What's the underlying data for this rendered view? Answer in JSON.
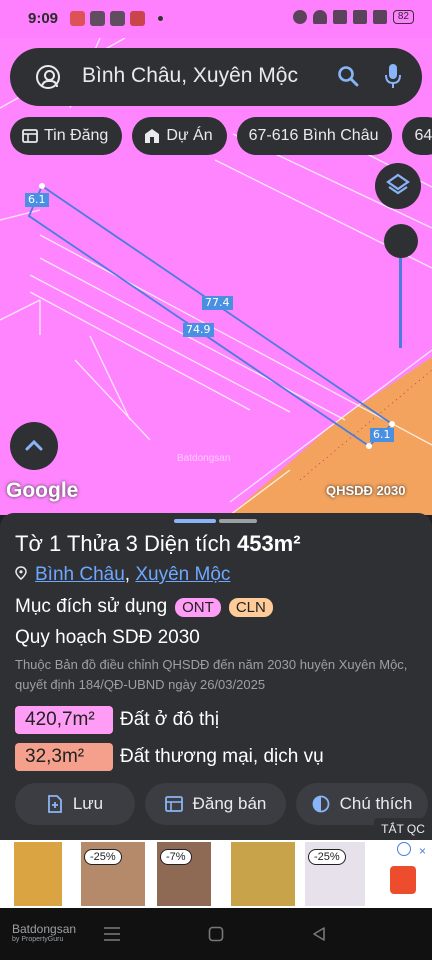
{
  "status": {
    "time": "9:09",
    "battery": "82"
  },
  "search": {
    "text": "Bình Châu, Xuyên Mộc"
  },
  "chips": [
    {
      "label": "Tin Đăng"
    },
    {
      "label": "Dự Án"
    },
    {
      "label": "67-616 Bình Châu"
    },
    {
      "label": "64"
    }
  ],
  "map": {
    "dimensions": [
      {
        "text": "6.1"
      },
      {
        "text": "77.4"
      },
      {
        "text": "74.9"
      },
      {
        "text": "6.1"
      }
    ],
    "google_logo": "Google",
    "layer_label": "QHSDĐ 2030",
    "watermark": "Batdongsan"
  },
  "panel": {
    "title_prefix": "Tờ 1",
    "title_middle": " Thửa 3",
    "title_area_label": " Diện tích ",
    "title_area": "453m²",
    "address_part1": "Bình Châu",
    "address_sep": ", ",
    "address_part2": "Xuyên Mộc",
    "purpose_label": "Mục đích sử dụng",
    "purpose_badges": [
      {
        "text": "ONT",
        "color": "#ff9cf5"
      },
      {
        "text": "CLN",
        "color": "#ffcc99"
      }
    ],
    "planning_title": "Quy hoạch SDĐ 2030",
    "description": "Thuộc Bản đồ điều chỉnh QHSDĐ đến năm 2030 huyện Xuyên Mộc, quyết định 184/QĐ-UBND ngày 26/03/2025",
    "areas": [
      {
        "value": "420,7m²",
        "label": "Đất ở đô thị",
        "color": "#ff9cf5"
      },
      {
        "value": "32,3m²",
        "label": "Đất thương mại, dịch vụ",
        "color": "#f5a08c"
      }
    ],
    "actions": [
      {
        "label": "Lưu"
      },
      {
        "label": "Đăng bán"
      },
      {
        "label": "Chú thích"
      }
    ]
  },
  "ad": {
    "close_label": "TẮT QC",
    "discounts": [
      "-25%",
      "-7%",
      "-25%"
    ]
  },
  "nav": {
    "logo": "Batdongsan",
    "logo_sub": "by PropertyGuru"
  }
}
